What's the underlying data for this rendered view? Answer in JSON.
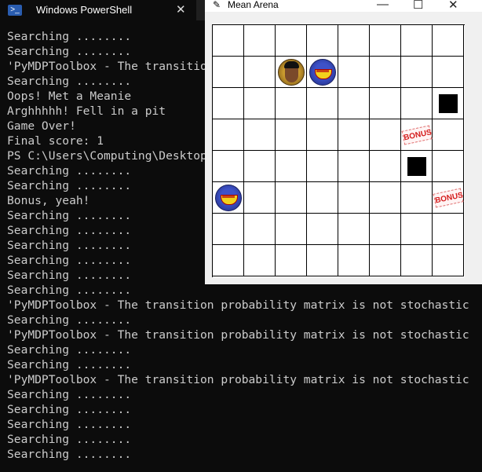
{
  "powershell": {
    "tab_title": "Windows PowerShell",
    "icon_glyph": ">_",
    "close_glyph": "✕",
    "lines": [
      "Searching ........",
      "Searching ........",
      "'PyMDPToolbox - The transition probability matrix is not stochastic",
      "Searching ........",
      "Oops! Met a Meanie",
      "Arghhhhh! Fell in a pit",
      "Game Over!",
      "Final score: 1",
      "PS C:\\Users\\Computing\\Desktop>",
      "Searching ........",
      "Searching ........",
      "Bonus, yeah!",
      "Searching ........",
      "Searching ........",
      "Searching ........",
      "Searching ........",
      "Searching ........",
      "Searching ........",
      "'PyMDPToolbox - The transition probability matrix is not stochastic",
      "Searching ........",
      "'PyMDPToolbox - The transition probability matrix is not stochastic",
      "Searching ........",
      "Searching ........",
      "'PyMDPToolbox - The transition probability matrix is not stochastic",
      "Searching ........",
      "Searching ........",
      "Searching ........",
      "Searching ........",
      "Searching ........"
    ]
  },
  "arena": {
    "title": "Mean Arena",
    "feather_glyph": "✎",
    "minimize_glyph": "—",
    "maximize_glyph": "☐",
    "close_glyph": "✕",
    "grid": {
      "rows": 8,
      "cols": 8
    },
    "bonus_label": "BONUS",
    "pieces": [
      {
        "kind": "player",
        "row": 1,
        "col": 2
      },
      {
        "kind": "meanie",
        "row": 1,
        "col": 3
      },
      {
        "kind": "meanie",
        "row": 5,
        "col": 0
      },
      {
        "kind": "pit",
        "row": 2,
        "col": 7
      },
      {
        "kind": "pit",
        "row": 4,
        "col": 6
      },
      {
        "kind": "bonus",
        "row": 3,
        "col": 6
      },
      {
        "kind": "bonus",
        "row": 5,
        "col": 7
      }
    ]
  }
}
